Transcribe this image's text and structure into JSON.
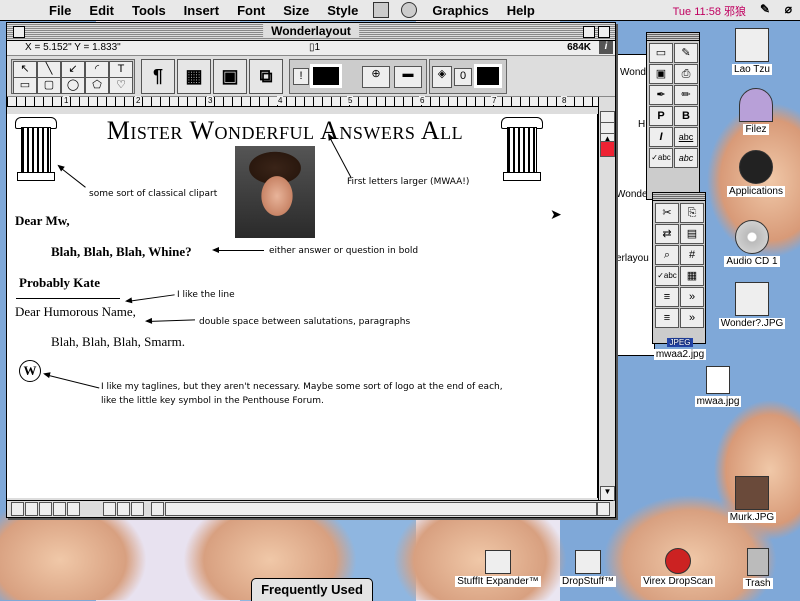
{
  "menubar": {
    "apple": "",
    "items": [
      "File",
      "Edit",
      "Tools",
      "Insert",
      "Font",
      "Size",
      "Style",
      "Graphics",
      "Help"
    ],
    "clock": "Tue 11:58 邪狼",
    "colors": {
      "clock": "#c00060"
    }
  },
  "window": {
    "title": "Wonderlayout",
    "coords": "X = 5.152\"   Y = 1.833\"",
    "page": "1",
    "memory": "684K",
    "info": "i"
  },
  "ruler": {
    "marks": [
      "1",
      "2",
      "3",
      "4",
      "5",
      "6",
      "7",
      "8"
    ]
  },
  "doc": {
    "heading": "Mister Wonderful Answers All",
    "notes": {
      "clipart": "some sort of classical clipart",
      "larger": "First letters larger (MWAA!)",
      "bold": "either answer or question in bold",
      "line": "I like the line",
      "space": "double space between salutations, paragraphs",
      "tag1": "I like my taglines, but they aren't necessary.  Maybe some sort of logo at the end of each,",
      "tag2": "like the little key symbol in the Penthouse Forum."
    },
    "dear": "Dear Mw,",
    "question": "Blah, Blah, Blah, Whine?",
    "signoff": "Probably Kate",
    "dear2": "Dear Humorous Name,",
    "answer": "Blah, Blah, Blah, Smarm.",
    "logo": "W"
  },
  "palette": {
    "label": "JPEG",
    "cells1": [
      "▭",
      "✎",
      "▣",
      "⎙",
      "✒",
      "✏",
      "P",
      "B",
      "I",
      "abc",
      "✓abc",
      "abc"
    ],
    "cells2": [
      "✂",
      "⎘",
      "⇄",
      "▤",
      "⌕",
      "#",
      "✓abc",
      "▦",
      "≡",
      "»",
      "≡",
      "»"
    ]
  },
  "behind_window": {
    "labels": [
      "Wond",
      "H",
      "Wonder",
      "erlayou"
    ]
  },
  "desktop": {
    "icons": [
      {
        "label": "Lao Tzu"
      },
      {
        "label": "Filez"
      },
      {
        "label": "Applications"
      },
      {
        "label": "Audio CD 1"
      },
      {
        "label": "Wonder?.JPG"
      },
      {
        "label": "mwaa2.jpg"
      },
      {
        "label": "mwaa.jpg"
      },
      {
        "label": "Murk.JPG"
      },
      {
        "label": "StuffIt Expander™"
      },
      {
        "label": "DropStuff™"
      },
      {
        "label": "Virex DropScan"
      },
      {
        "label": "Trash"
      }
    ],
    "jpeg_badge": "JPEG"
  },
  "tab": {
    "label": "Frequently Used"
  }
}
